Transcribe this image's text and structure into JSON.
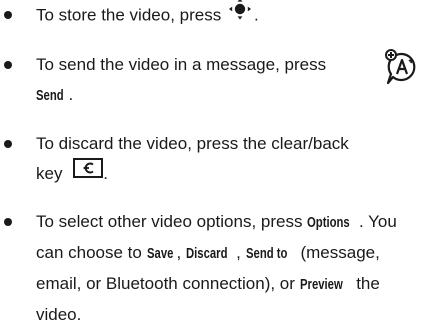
{
  "items": [
    {
      "lines": [
        {
          "before": "To store the video, press ",
          "after": "."
        }
      ],
      "icon": "nav-center-key-icon"
    },
    {
      "lines": [
        {
          "text": "To send the video in a message, press"
        },
        {
          "key": "Send",
          "after": "."
        }
      ],
      "side_icon": "messaging-network-icon"
    },
    {
      "lines": [
        {
          "text": "To discard the video, press the clear/back"
        },
        {
          "before": "key ",
          "after": "."
        }
      ],
      "icon": "clear-back-key-icon"
    },
    {
      "lines": [
        {
          "before": "To select other video options, press ",
          "key": "Options",
          "after": ". You"
        },
        {
          "before": "can choose to ",
          "key1": "Save",
          "sep1": ", ",
          "key2": "Discard",
          "sep2": ", ",
          "key3": "Send to",
          "after": " (message,"
        },
        {
          "text": "email, or Bluetooth connection), or ",
          "key": "Preview",
          "after": " the"
        },
        {
          "text": "video."
        }
      ]
    }
  ],
  "colors": {
    "text": "#1a1a1a",
    "background": "#ffffff"
  }
}
